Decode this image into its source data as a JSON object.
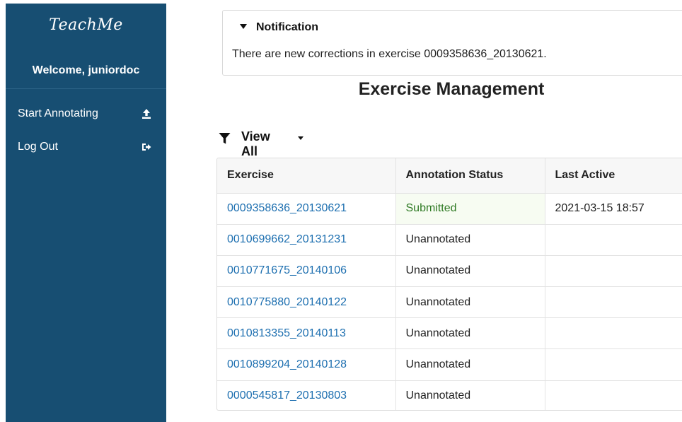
{
  "sidebar": {
    "logo_text": "TeachMe",
    "welcome": "Welcome, juniordoc",
    "items": [
      {
        "label": "Start Annotating",
        "icon": "upload-icon"
      },
      {
        "label": "Log Out",
        "icon": "sign-out-icon"
      }
    ]
  },
  "notification": {
    "title": "Notification",
    "message": "There are new corrections in exercise 0009358636_20130621."
  },
  "page": {
    "title": "Exercise Management"
  },
  "filter": {
    "label": "View All",
    "icon": "filter-icon"
  },
  "table": {
    "headers": [
      "Exercise",
      "Annotation Status",
      "Last Active"
    ],
    "rows": [
      {
        "exercise": "0009358636_20130621",
        "status": "Submitted",
        "last_active": "2021-03-15 18:57"
      },
      {
        "exercise": "0010699662_20131231",
        "status": "Unannotated",
        "last_active": ""
      },
      {
        "exercise": "0010771675_20140106",
        "status": "Unannotated",
        "last_active": ""
      },
      {
        "exercise": "0010775880_20140122",
        "status": "Unannotated",
        "last_active": ""
      },
      {
        "exercise": "0010813355_20140113",
        "status": "Unannotated",
        "last_active": ""
      },
      {
        "exercise": "0010899204_20140128",
        "status": "Unannotated",
        "last_active": ""
      },
      {
        "exercise": "0000545817_20130803",
        "status": "Unannotated",
        "last_active": ""
      }
    ]
  },
  "colors": {
    "sidebar_bg": "#174e72",
    "link": "#1d6fb0",
    "submitted_text": "#2f7a24",
    "submitted_bg": "#f7fcf2"
  }
}
